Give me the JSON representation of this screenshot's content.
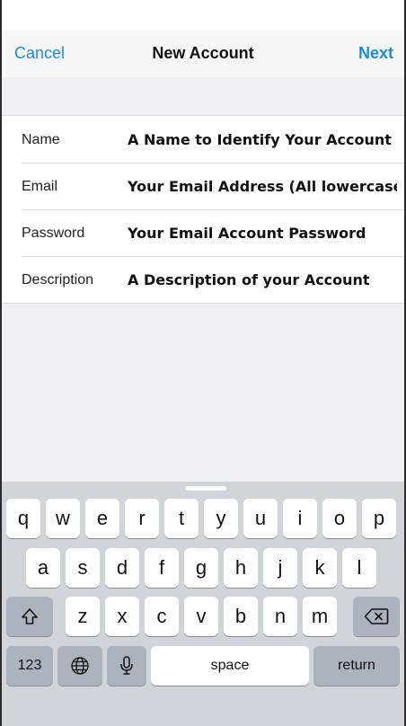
{
  "nav": {
    "cancel_label": "Cancel",
    "title": "New Account",
    "next_label": "Next"
  },
  "form": {
    "fields": [
      {
        "label": "Name",
        "placeholder": "A Name to Identify Your Account"
      },
      {
        "label": "Email",
        "placeholder": "Your Email Address (All lowercase)"
      },
      {
        "label": "Password",
        "placeholder": "Your Email Account Password"
      },
      {
        "label": "Description",
        "placeholder": "A Description of your Account"
      }
    ]
  },
  "keyboard": {
    "row1": [
      "q",
      "w",
      "e",
      "r",
      "t",
      "y",
      "u",
      "i",
      "o",
      "p"
    ],
    "row2": [
      "a",
      "s",
      "d",
      "f",
      "g",
      "h",
      "j",
      "k",
      "l"
    ],
    "row3": [
      "z",
      "x",
      "c",
      "v",
      "b",
      "n",
      "m"
    ],
    "numbers_label": "123",
    "space_label": "space",
    "return_label": "return",
    "icons": {
      "shift": "shift-icon",
      "delete": "delete-icon",
      "globe": "globe-icon",
      "mic": "microphone-icon"
    }
  }
}
